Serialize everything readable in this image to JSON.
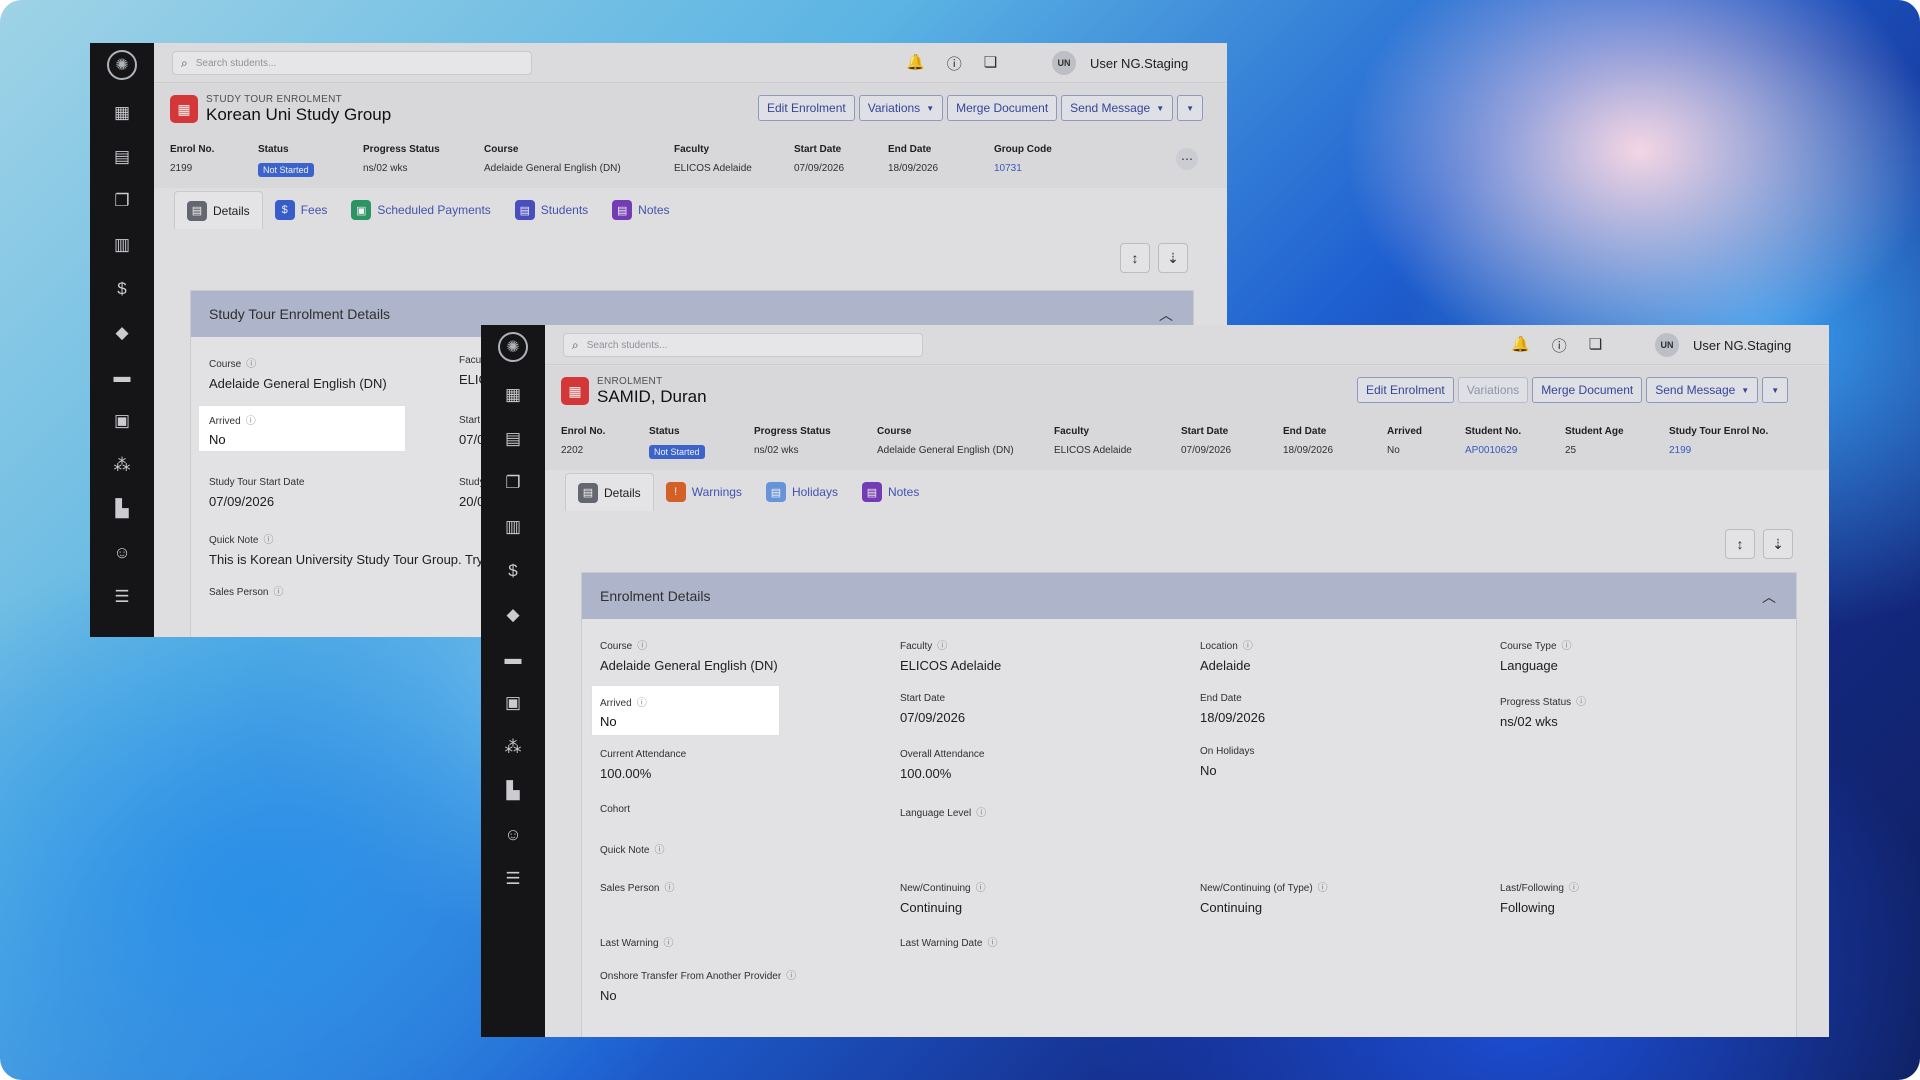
{
  "search_placeholder": "Search students...",
  "user": {
    "initials": "UN",
    "name": "User NG.Staging"
  },
  "back": {
    "type_label": "STUDY TOUR ENROLMENT",
    "title": "Korean Uni Study Group",
    "buttons": {
      "edit": "Edit Enrolment",
      "variations": "Variations",
      "merge": "Merge Document",
      "send": "Send Message"
    },
    "stats": [
      {
        "key": "Enrol No.",
        "value": "2199"
      },
      {
        "key": "Status",
        "value": "Not Started",
        "badge": true
      },
      {
        "key": "Progress Status",
        "value": "ns/02 wks"
      },
      {
        "key": "Course",
        "value": "Adelaide General English (DN)"
      },
      {
        "key": "Faculty",
        "value": "ELICOS Adelaide"
      },
      {
        "key": "Start Date",
        "value": "07/09/2026"
      },
      {
        "key": "End Date",
        "value": "18/09/2026"
      },
      {
        "key": "Group Code",
        "value": "10731",
        "link": true
      }
    ],
    "tabs": [
      "Details",
      "Fees",
      "Scheduled Payments",
      "Students",
      "Notes"
    ],
    "panel_title": "Study Tour Enrolment Details",
    "fields": {
      "course_label": "Course",
      "course_value": "Adelaide General English (DN)",
      "faculty_label": "Facul",
      "faculty_value": "ELIC",
      "arrived_label": "Arrived",
      "arrived_value": "No",
      "start_label": "Start",
      "start_value": "07/0",
      "st_start_label": "Study Tour Start Date",
      "st_start_value": "07/09/2026",
      "st_end_label": "Study",
      "st_end_value": "20/0",
      "quick_label": "Quick Note",
      "quick_value": "This is Korean University Study Tour Group. Try a",
      "sales_label": "Sales Person"
    }
  },
  "front": {
    "type_label": "ENROLMENT",
    "title": "SAMID, Duran",
    "buttons": {
      "edit": "Edit Enrolment",
      "variations": "Variations",
      "merge": "Merge Document",
      "send": "Send Message"
    },
    "stats": [
      {
        "key": "Enrol No.",
        "value": "2202"
      },
      {
        "key": "Status",
        "value": "Not Started",
        "badge": true
      },
      {
        "key": "Progress Status",
        "value": "ns/02 wks"
      },
      {
        "key": "Course",
        "value": "Adelaide General English (DN)"
      },
      {
        "key": "Faculty",
        "value": "ELICOS Adelaide"
      },
      {
        "key": "Start Date",
        "value": "07/09/2026"
      },
      {
        "key": "End Date",
        "value": "18/09/2026"
      },
      {
        "key": "Arrived",
        "value": "No"
      },
      {
        "key": "Student No.",
        "value": "AP0010629",
        "link": true
      },
      {
        "key": "Student Age",
        "value": "25"
      },
      {
        "key": "Study Tour Enrol No.",
        "value": "2199",
        "link": true
      }
    ],
    "tabs": [
      "Details",
      "Warnings",
      "Holidays",
      "Notes"
    ],
    "panel_title": "Enrolment Details",
    "fields": [
      {
        "label": "Course",
        "value": "Adelaide General English (DN)"
      },
      {
        "label": "Faculty",
        "value": "ELICOS Adelaide"
      },
      {
        "label": "Location",
        "value": "Adelaide"
      },
      {
        "label": "Course Type",
        "value": "Language"
      },
      {
        "label": "Arrived",
        "value": "No"
      },
      {
        "label": "Start Date",
        "value": "07/09/2026"
      },
      {
        "label": "End Date",
        "value": "18/09/2026"
      },
      {
        "label": "Progress Status",
        "value": "ns/02 wks"
      },
      {
        "label": "Current Attendance",
        "value": "100.00%"
      },
      {
        "label": "Overall Attendance",
        "value": "100.00%"
      },
      {
        "label": "On Holidays",
        "value": "No"
      },
      {
        "label": "Cohort",
        "value": ""
      },
      {
        "label": "Language Level",
        "value": ""
      },
      {
        "label": "Quick Note",
        "value": ""
      },
      {
        "label": "Sales Person",
        "value": ""
      },
      {
        "label": "New/Continuing",
        "value": "Continuing"
      },
      {
        "label": "New/Continuing (of Type)",
        "value": "Continuing"
      },
      {
        "label": "Last/Following",
        "value": "Following"
      },
      {
        "label": "Last Warning",
        "value": ""
      },
      {
        "label": "Last Warning Date",
        "value": ""
      },
      {
        "label": "Onshore Transfer From Another Provider",
        "value": "No"
      }
    ]
  },
  "icons": {
    "rail": [
      "dashboard-icon",
      "student-icon",
      "enrolments-icon",
      "layout-icon",
      "finance-icon",
      "graduation-icon",
      "book-icon",
      "briefcase-icon",
      "network-icon",
      "building-icon",
      "users-icon",
      "settings-sliders-icon"
    ],
    "top": [
      "bell-icon",
      "help-icon",
      "chat-icon"
    ]
  },
  "colors": {
    "status_badge": "#3f6ad8",
    "link": "#3a62c8",
    "header_icon": "#e23b3b",
    "panel_header": "#b9c0d7"
  }
}
